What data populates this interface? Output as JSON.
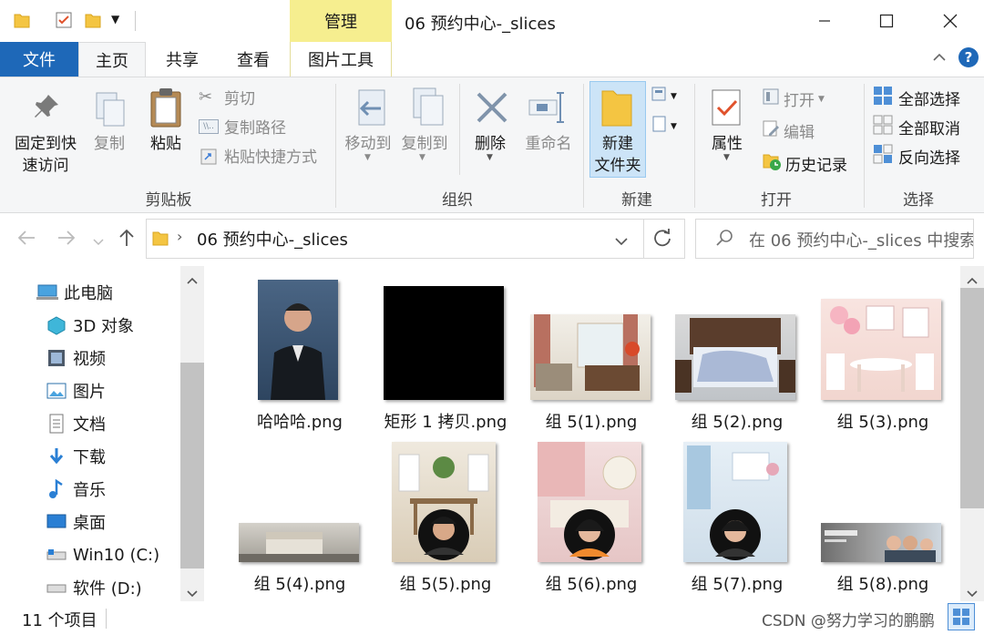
{
  "window": {
    "title": "06 预约中心-_slices",
    "context_tab": "管理",
    "minimize": "—",
    "maximize": "☐",
    "close": "✕"
  },
  "tabs": {
    "file": "文件",
    "home": "主页",
    "share": "共享",
    "view": "查看",
    "picture_tools": "图片工具"
  },
  "ribbon": {
    "clipboard": {
      "label": "剪贴板",
      "pin_line1": "固定到快",
      "pin_line2": "速访问",
      "copy": "复制",
      "paste": "粘贴",
      "cut": "剪切",
      "copy_path": "复制路径",
      "paste_shortcut": "粘贴快捷方式"
    },
    "organize": {
      "label": "组织",
      "move_to": "移动到",
      "copy_to": "复制到",
      "delete": "删除",
      "rename": "重命名"
    },
    "new": {
      "label": "新建",
      "new_folder_line1": "新建",
      "new_folder_line2": "文件夹"
    },
    "open": {
      "label": "打开",
      "properties": "属性",
      "open": "打开",
      "edit": "编辑",
      "history": "历史记录"
    },
    "select": {
      "label": "选择",
      "select_all": "全部选择",
      "select_none": "全部取消",
      "invert": "反向选择"
    }
  },
  "address": {
    "path": "06 预约中心-_slices",
    "search_placeholder": "在 06 预约中心-_slices 中搜索"
  },
  "nav": {
    "items": [
      {
        "label": "此电脑",
        "icon": "computer-icon"
      },
      {
        "label": "3D 对象",
        "icon": "3d-objects-icon"
      },
      {
        "label": "视频",
        "icon": "video-icon"
      },
      {
        "label": "图片",
        "icon": "pictures-icon"
      },
      {
        "label": "文档",
        "icon": "documents-icon"
      },
      {
        "label": "下载",
        "icon": "download-icon"
      },
      {
        "label": "音乐",
        "icon": "music-icon"
      },
      {
        "label": "桌面",
        "icon": "desktop-icon"
      },
      {
        "label": "Win10 (C:)",
        "icon": "drive-icon"
      },
      {
        "label": "软件 (D:)",
        "icon": "drive-icon"
      }
    ]
  },
  "files": [
    {
      "name": "哈哈哈.png"
    },
    {
      "name": "矩形 1 拷贝.png"
    },
    {
      "name": "组 5(1).png"
    },
    {
      "name": "组 5(2).png"
    },
    {
      "name": "组 5(3).png"
    },
    {
      "name": "组 5(4).png"
    },
    {
      "name": "组 5(5).png"
    },
    {
      "name": "组 5(6).png"
    },
    {
      "name": "组 5(7).png"
    },
    {
      "name": "组 5(8).png"
    }
  ],
  "status": {
    "count": "11 个项目"
  },
  "watermark": "CSDN @努力学习的鹏鹏"
}
